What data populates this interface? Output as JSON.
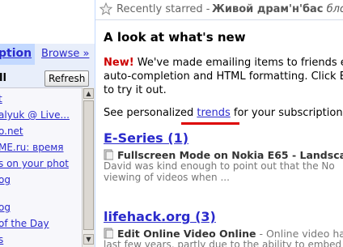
{
  "sidebar": {
    "cut_tab_label": "ption",
    "browse_label": "Browse »",
    "all_label": "ll",
    "refresh_label": "Refresh",
    "items": [
      "t",
      "alyuk @ Live...",
      "o.net",
      "ME.ru: время",
      "s on your phot",
      "og",
      "og",
      "of the Day",
      "s"
    ]
  },
  "starred": {
    "label": "Recently starred - ",
    "title_bold": "Живой драм'н'бас",
    "title_rest": " бло"
  },
  "whats_new": {
    "heading": "A look at what's new",
    "new_tag": "New!",
    "line1": " We've made emailing items to friends ev",
    "line2": "auto-completion and HTML formatting. Click En",
    "line3": "to try it out.",
    "trends_prefix": "See personalized ",
    "trends_link": "trends",
    "trends_suffix": " for your subscriptions"
  },
  "feeds": [
    {
      "title": "E-Series (1)",
      "entry_title": "Fullscreen Mode on Nokia E65 - Landsca",
      "snippet1": "David was kind enough to point out that the No",
      "snippet2": "viewing of videos when ..."
    },
    {
      "title": "lifehack.org (3)",
      "entry_title": "Edit Online Video Online",
      "entry_snippet": " - Online video ha",
      "snippet1": "last few years, partly due to the ability to embed"
    }
  ],
  "icons": {
    "star": "star-icon",
    "doc": "doc-icon",
    "scroll_up": "scroll-up-arrow-icon",
    "scroll_down": "scroll-down-arrow-icon"
  },
  "colors": {
    "link": "#2a2acc",
    "tab_bg": "#c3d9ff",
    "panel_bg": "#e8eefa",
    "new_red": "#cc0000",
    "underline_red": "#dd0000"
  }
}
